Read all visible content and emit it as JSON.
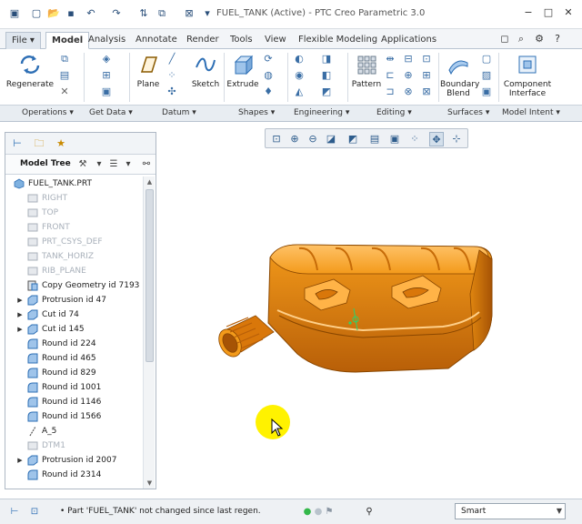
{
  "titlebar": {
    "title": "FUEL_TANK (Active) - PTC Creo Parametric 3.0"
  },
  "tabs": [
    {
      "label": "File ▾"
    },
    {
      "label": "Model"
    },
    {
      "label": "Analysis"
    },
    {
      "label": "Annotate"
    },
    {
      "label": "Render"
    },
    {
      "label": "Tools"
    },
    {
      "label": "View"
    },
    {
      "label": "Flexible Modeling"
    },
    {
      "label": "Applications"
    }
  ],
  "ribbon": {
    "regenerate": "Regenerate",
    "plane": "Plane",
    "sketch": "Sketch",
    "extrude": "Extrude",
    "pattern": "Pattern",
    "boundary_line1": "Boundary",
    "boundary_line2": "Blend",
    "component_line1": "Component",
    "component_line2": "Interface"
  },
  "groups": [
    {
      "label": "Operations ▾"
    },
    {
      "label": "Get Data ▾"
    },
    {
      "label": "Datum ▾"
    },
    {
      "label": "Shapes ▾"
    },
    {
      "label": "Engineering ▾"
    },
    {
      "label": "Editing ▾"
    },
    {
      "label": "Surfaces ▾"
    },
    {
      "label": "Model Intent ▾"
    }
  ],
  "model_tree": {
    "header": "Model Tree",
    "root": "FUEL_TANK.PRT",
    "items": [
      {
        "label": "RIGHT",
        "expand": ""
      },
      {
        "label": "TOP",
        "expand": ""
      },
      {
        "label": "FRONT",
        "expand": ""
      },
      {
        "label": "PRT_CSYS_DEF",
        "expand": ""
      },
      {
        "label": "TANK_HORIZ",
        "expand": ""
      },
      {
        "label": "RIB_PLANE",
        "expand": ""
      },
      {
        "label": "Copy Geometry id 7193",
        "expand": ""
      },
      {
        "label": "Protrusion id 47",
        "expand": "▶"
      },
      {
        "label": "Cut id 74",
        "expand": "▶"
      },
      {
        "label": "Cut id 145",
        "expand": "▶"
      },
      {
        "label": "Round id 224",
        "expand": ""
      },
      {
        "label": "Round id 465",
        "expand": ""
      },
      {
        "label": "Round id 829",
        "expand": ""
      },
      {
        "label": "Round id 1001",
        "expand": ""
      },
      {
        "label": "Round id 1146",
        "expand": ""
      },
      {
        "label": "Round id 1566",
        "expand": ""
      },
      {
        "label": "A_5",
        "expand": ""
      },
      {
        "label": "DTM1",
        "expand": ""
      },
      {
        "label": "Protrusion id 2007",
        "expand": "▶"
      },
      {
        "label": "Round id 2314",
        "expand": ""
      }
    ]
  },
  "statusbar": {
    "message": "• Part 'FUEL_TANK' not changed since last regen.",
    "filter_value": "Smart"
  },
  "colors": {
    "model_orange": "#f39a1a",
    "model_highlight": "#ffc267",
    "model_shadow": "#b85f08",
    "cursor_highlight": "#fff200",
    "datum_grey": "#a8b0ba"
  }
}
